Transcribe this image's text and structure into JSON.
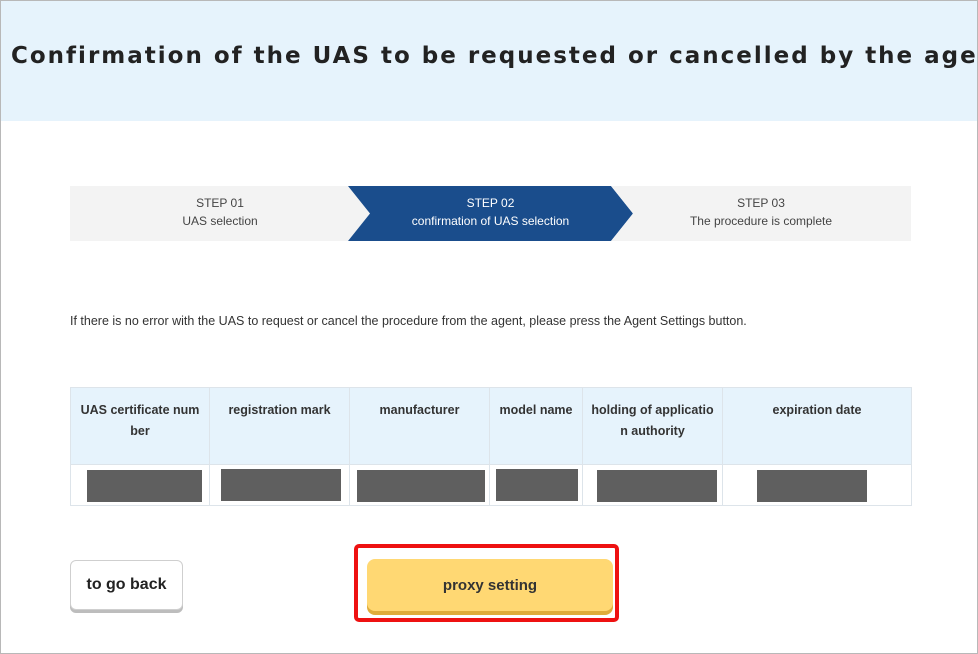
{
  "page": {
    "title": "Confirmation of the UAS to be requested or cancelled by the agent"
  },
  "steps": [
    {
      "number": "STEP 01",
      "label": "UAS selection",
      "active": false
    },
    {
      "number": "STEP 02",
      "label": "confirmation of UAS selection",
      "active": true
    },
    {
      "number": "STEP 03",
      "label": "The procedure is complete",
      "active": false
    }
  ],
  "instruction": "If there is no error with the UAS to request or cancel the procedure from the agent, please press the Agent Settings button.",
  "table": {
    "headers": [
      "UAS certificate number",
      "registration mark",
      "manufacturer",
      "model name",
      "holding of application authority",
      "expiration date"
    ],
    "rows": [
      {
        "cells": [
          "",
          "",
          "",
          "",
          "",
          ""
        ],
        "redacted": true
      }
    ]
  },
  "buttons": {
    "back_label": "to go back",
    "proxy_label": "proxy setting"
  },
  "colors": {
    "header_bg": "#e6f3fc",
    "step_active": "#1a4d8c",
    "proxy_button": "#ffd873",
    "highlight": "#ee1111"
  }
}
